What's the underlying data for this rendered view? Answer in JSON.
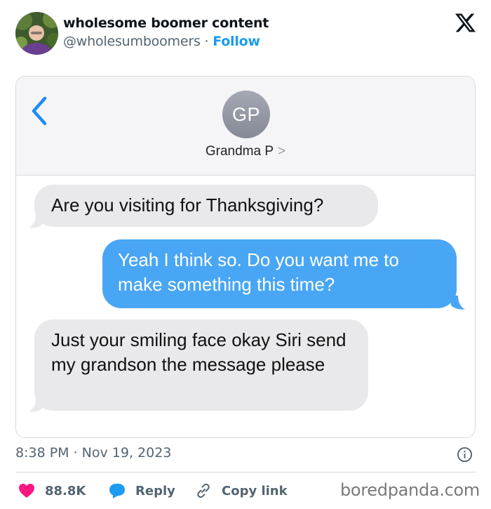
{
  "tweet": {
    "author_name": "wholesome boomer content",
    "handle": "@wholesumboomers",
    "separator": "·",
    "follow_label": "Follow",
    "timestamp": "8:38 PM · Nov 19, 2023"
  },
  "conversation": {
    "contact_initials": "GP",
    "contact_name": "Grandma P",
    "contact_chevron": ">",
    "messages": [
      {
        "direction": "incoming",
        "text": "Are you visiting for Thanksgiving?"
      },
      {
        "direction": "outgoing",
        "text": "Yeah I think so. Do you want me to make something this time?"
      },
      {
        "direction": "incoming",
        "text": "Just your smiling face okay Siri send my grandson the message please"
      }
    ]
  },
  "actions": {
    "like_count": "88.8K",
    "reply_label": "Reply",
    "copy_link_label": "Copy link"
  },
  "watermark": "boredpanda.com",
  "colors": {
    "like": "#f91880",
    "reply": "#1d9bf0",
    "follow": "#1d9bf0",
    "ios_back": "#1a8cf6",
    "outgoing_bubble": "#48a6f4",
    "incoming_bubble": "#e9e9eb"
  },
  "icons": {
    "close": "x-logo-icon",
    "info": "info-icon",
    "like": "heart-icon",
    "reply": "speech-bubble-icon",
    "copy_link": "link-icon",
    "back": "chevron-left-icon"
  }
}
